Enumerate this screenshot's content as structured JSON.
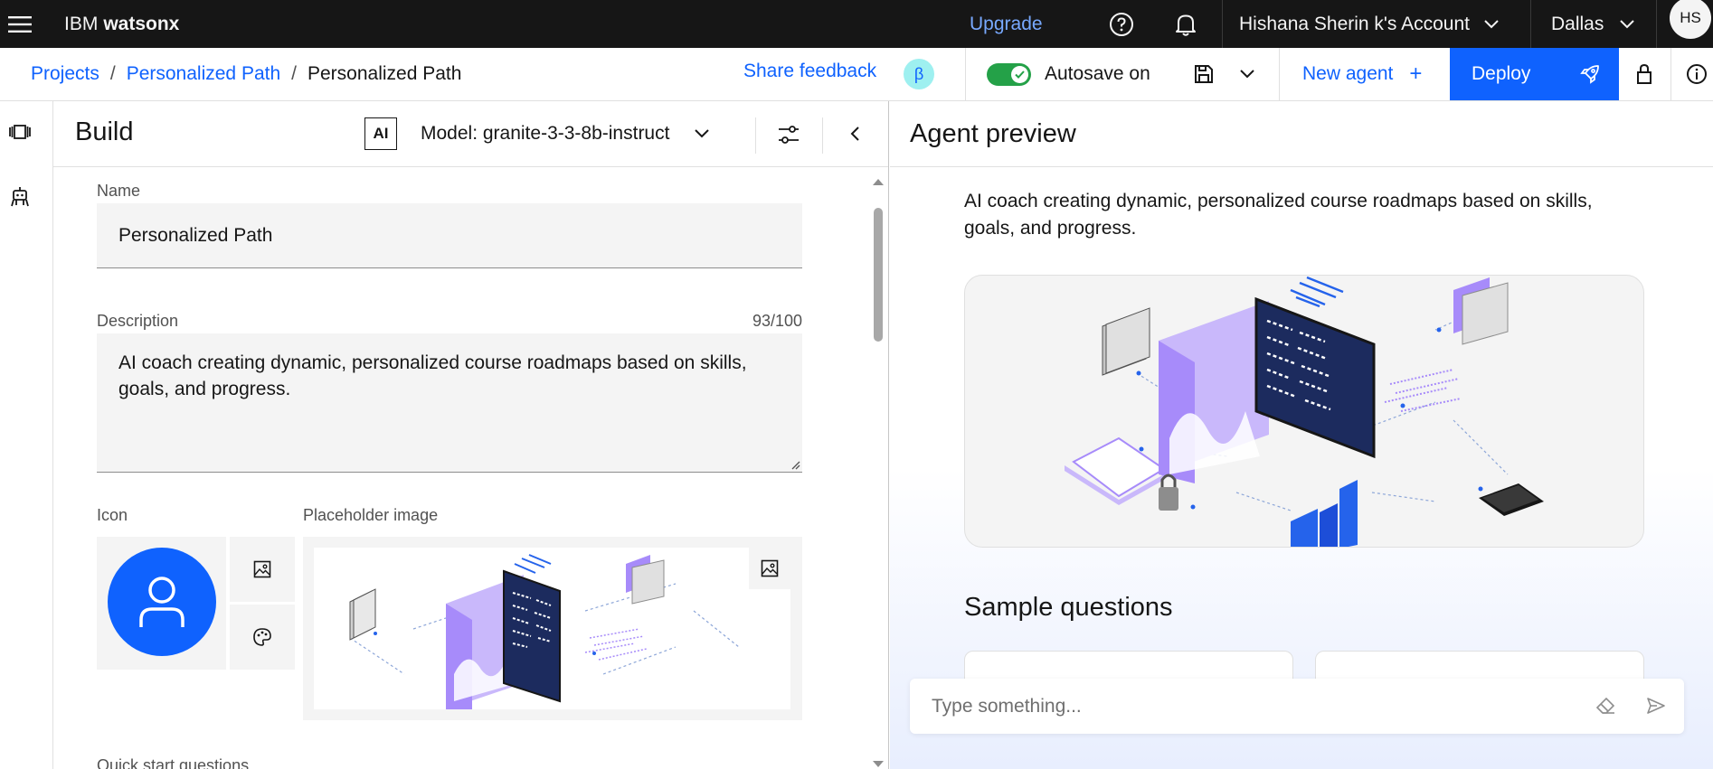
{
  "topbar": {
    "brand_prefix": "IBM",
    "brand_name": "watsonx",
    "upgrade": "Upgrade",
    "account": "Hishana Sherin k's Account",
    "region": "Dallas",
    "avatar_initials": "HS"
  },
  "subheader": {
    "breadcrumb": [
      "Projects",
      "Personalized Path",
      "Personalized Path"
    ],
    "breadcrumb_sep": "/",
    "share_feedback": "Share feedback",
    "beta_badge": "β",
    "autosave": "Autosave on",
    "new_agent": "New agent",
    "new_agent_plus": "+",
    "deploy": "Deploy"
  },
  "build": {
    "title": "Build",
    "ai_badge": "AI",
    "model": "Model: granite-3-3-8b-instruct",
    "name_label": "Name",
    "name_value": "Personalized Path",
    "description_label": "Description",
    "description_count": "93/100",
    "description_value": "AI coach creating dynamic, personalized course roadmaps based on skills, goals, and progress.",
    "icon_label": "Icon",
    "placeholder_label": "Placeholder image",
    "quick_start_label": "Quick start questions"
  },
  "preview": {
    "title": "Agent preview",
    "description": "AI coach creating dynamic, personalized course roadmaps based on skills, goals, and progress.",
    "sample_questions": "Sample questions",
    "input_placeholder": "Type something..."
  },
  "colors": {
    "topbar_bg": "#161616",
    "accent_blue": "#0f62fe",
    "upgrade_link": "#78a9ff",
    "toggle_green": "#24a148",
    "avatar_blue": "#0f62fe",
    "illustration_purple": "#a78bfa"
  }
}
